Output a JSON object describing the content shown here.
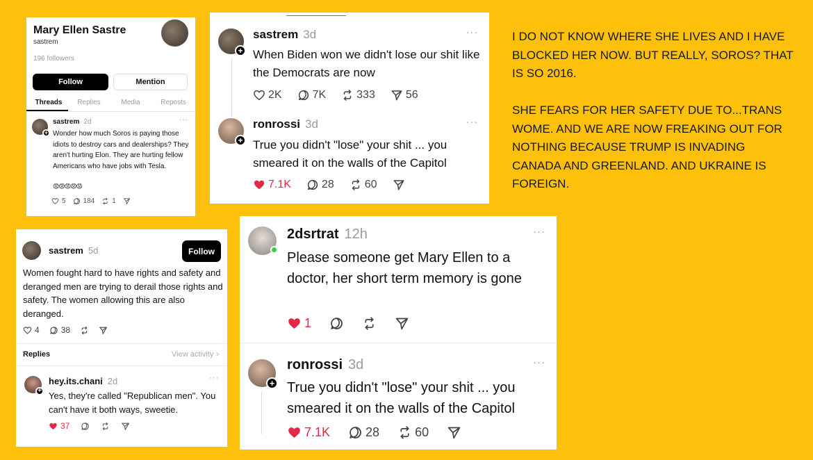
{
  "colors": {
    "background": "#FDC10C",
    "like_red": "#E02A48",
    "follow_black": "#000000"
  },
  "card1": {
    "profile_name": "Mary Ellen Sastre",
    "handle": "sastrem",
    "followers": "196 followers",
    "follow_label": "Follow",
    "mention_label": "Mention",
    "tabs": [
      "Threads",
      "Replies",
      "Media",
      "Reposts"
    ],
    "post": {
      "user": "sastrem",
      "time": "2d",
      "text": "Wonder how much Soros is paying those idiots to destroy cars and dealerships? They aren't hurting Elon. They are hurting fellow Americans who have jobs with Tesla.",
      "emojis": "😡😡😡😡😡",
      "likes": "5",
      "replies": "184",
      "reposts": "1"
    }
  },
  "card2": {
    "post1": {
      "user": "sastrem",
      "time": "3d",
      "text": "When Biden won we didn't lose our shit like the Democrats are now",
      "likes": "2K",
      "replies": "7K",
      "reposts": "333",
      "shares": "56"
    },
    "post2": {
      "user": "ronrossi",
      "time": "3d",
      "text": "True you didn't \"lose\" your shit ... you smeared it on the walls of the Capitol",
      "likes": "7.1K",
      "replies": "28",
      "reposts": "60"
    }
  },
  "commentary": {
    "para1": "I DO NOT KNOW WHERE SHE LIVES AND I HAVE BLOCKED HER NOW. BUT REALLY, SOROS? THAT IS SO 2016.",
    "para2": "SHE FEARS FOR HER SAFETY DUE TO...TRANS WOME. AND WE ARE NOW FREAKING OUT FOR NOTHING BECAUSE TRUMP IS INVADING CANADA AND GREENLAND. AND UKRAINE IS FOREIGN."
  },
  "card3": {
    "post": {
      "user": "sastrem",
      "time": "5d",
      "follow_label": "Follow",
      "text": "Women fought hard to have rights and safety and deranged men are trying to derail those rights and safety.  The women allowing this are also deranged.",
      "likes": "4",
      "replies": "38"
    },
    "replies_header": "Replies",
    "view_activity": "View activity",
    "reply": {
      "user": "hey.its.chani",
      "time": "2d",
      "text": "Yes, they're called \"Republican men\". You can't have it both ways, sweetie.",
      "likes": "37"
    }
  },
  "card4": {
    "post1": {
      "user": "2dsrtrat",
      "time": "12h",
      "text": "Please someone get Mary Ellen to a doctor, her short term memory is gone",
      "likes": "1"
    },
    "post2": {
      "user": "ronrossi",
      "time": "3d",
      "text": "True you didn't \"lose\" your shit ... you smeared it on the walls of the Capitol",
      "likes": "7.1K",
      "replies": "28",
      "reposts": "60"
    }
  }
}
